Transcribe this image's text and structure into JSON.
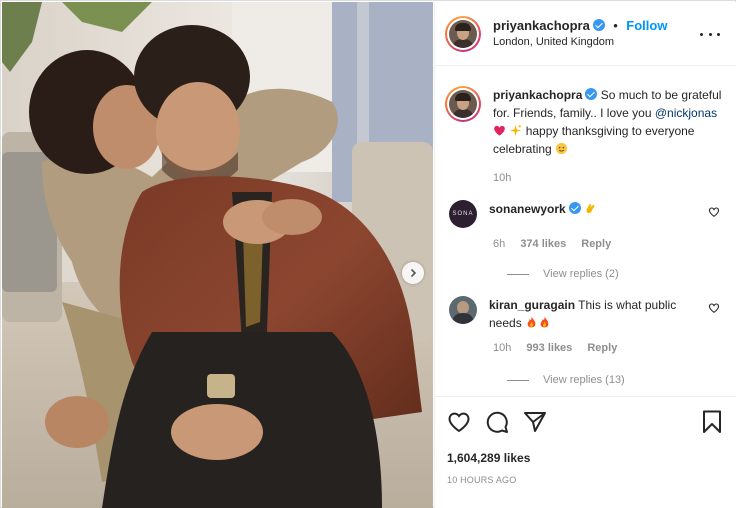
{
  "post": {
    "author": "priyankachopra",
    "follow_label": "Follow",
    "separator": "•",
    "location": "London, United Kingdom"
  },
  "caption": {
    "username": "priyankachopra",
    "text_1": "So much to be grateful for. Friends, family.. I love you",
    "mention": "@nickjonas",
    "text_2": "happy thanksgiving to everyone celebrating",
    "time": "10h"
  },
  "comments": [
    {
      "username": "sonanewyork",
      "avatar_text": "SONA",
      "time": "6h",
      "likes": "374 likes",
      "reply_label": "Reply",
      "view_replies": "View replies (2)"
    },
    {
      "username": "kiran_guragain",
      "text": "This is what public needs",
      "time": "10h",
      "likes": "993 likes",
      "reply_label": "Reply",
      "view_replies": "View replies (13)"
    }
  ],
  "footer": {
    "likes": "1,604,289 likes",
    "posted": "10 HOURS AGO"
  },
  "icons": {
    "like": "heart-icon",
    "comment": "comment-icon",
    "share": "share-icon",
    "save": "bookmark-icon",
    "more": "more-options-icon",
    "next": "chevron-right-icon"
  },
  "colors": {
    "link_blue": "#0095f6",
    "verified_blue": "#3897f0",
    "mention": "#00376b",
    "muted": "#8e8e8e"
  }
}
